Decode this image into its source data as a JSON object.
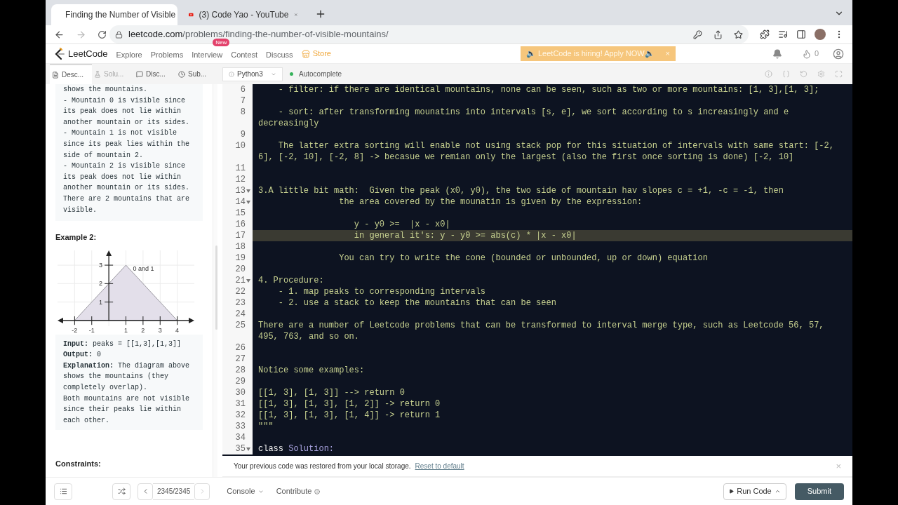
{
  "browser": {
    "tabs": [
      {
        "title": "Finding the Number of Visible",
        "kind": "leetcode",
        "selected": true
      },
      {
        "title": "(3) Code Yao - YouTube",
        "kind": "youtube",
        "selected": false
      }
    ],
    "url_host": "leetcode.com",
    "url_path": "/problems/finding-the-number-of-visible-mountains/"
  },
  "nav": {
    "logo": "LeetCode",
    "items": [
      {
        "label": "Explore"
      },
      {
        "label": "Problems"
      },
      {
        "label": "Interview",
        "badge": "New"
      },
      {
        "label": "Contest"
      },
      {
        "label": "Discuss"
      }
    ],
    "store": "Store",
    "banner": "🔈 LeetCode is hiring! Apply NOW🔈",
    "banner_close": "×",
    "streak": "0"
  },
  "panel_tabs": [
    {
      "label": "Desc...",
      "selected": true,
      "disabled": false
    },
    {
      "label": "Solu...",
      "selected": false,
      "disabled": true
    },
    {
      "label": "Disc...",
      "selected": false,
      "disabled": false
    },
    {
      "label": "Sub...",
      "selected": false,
      "disabled": false
    }
  ],
  "language": "Python3",
  "autocomplete": {
    "label": "Autocomplete",
    "on": true
  },
  "description": {
    "example1_lines": [
      "shows the mountains.",
      "- Mountain 0 is visible since its peak does not lie within another mountain or its sides.",
      "- Mountain 1 is not visible since its peak lies within the side of mountain 2.",
      "- Mountain 2 is visible since its peak does not lie within another mountain or its sides.",
      "There are 2 mountains that are visible."
    ],
    "example2_title": "Example 2:",
    "chart_data": {
      "type": "area",
      "x": [
        -2,
        1,
        4
      ],
      "series": [
        {
          "name": "0 and 1",
          "color": "#e3dfea",
          "values": [
            0,
            3,
            0
          ]
        }
      ],
      "xticks": [
        -2,
        -1,
        1,
        2,
        3,
        4
      ],
      "yticks": [
        1,
        2,
        3
      ],
      "xlim": [
        -3,
        5
      ],
      "ylim": [
        0,
        3.8
      ],
      "grid": true
    },
    "example2_fields": [
      {
        "label": "Input:",
        "value": "peaks = [[1,3],[1,3]]"
      },
      {
        "label": "Output:",
        "value": "0"
      },
      {
        "label": "Explanation:",
        "value": "The diagram above shows the mountains (they completely overlap)."
      }
    ],
    "example2_note": "Both mountains are not visible since their peaks lie within each other.",
    "constraints_title": "Constraints:"
  },
  "editor": {
    "lines": [
      {
        "n": "6",
        "text": "    - filter: if there are identical mountains, none can be seen, such as two or more mountains: [1, 3],[1, 3];",
        "fold": false,
        "active": false
      },
      {
        "n": "7",
        "fold": false,
        "active": false
      },
      {
        "n": "8",
        "text": "    - sort: after transforming mounatins into intervals [s, e], we sort according to s increasingly and e decreasingly",
        "fold": false,
        "active": false
      },
      {
        "n": "9",
        "fold": false,
        "active": false
      },
      {
        "n": "10",
        "text": "    The latter extra sorting will enable not using stack pop for this situation of intervals with same start: [-2, 6], [-2, 10], [-2, 8] -> becasue we remian only the largest (also the first once sorting is done) [-2, 10]",
        "fold": false,
        "active": false
      },
      {
        "n": "11",
        "fold": false,
        "active": false
      },
      {
        "n": "12",
        "fold": false,
        "active": false
      },
      {
        "n": "13",
        "text": "3.A little bit math:  Given the peak (x0, y0), the two side of mountain hav slopes c = +1, -c = -1, then",
        "fold": true,
        "active": false
      },
      {
        "n": "14",
        "text": "                the area covered by the mounatin is given by the expression:",
        "fold": true,
        "active": false
      },
      {
        "n": "15",
        "fold": false,
        "active": false
      },
      {
        "n": "16",
        "text": "                   y - y0 >=  |x - x0|",
        "fold": false,
        "active": false
      },
      {
        "n": "17",
        "text": "                   in general it's: y - y0 >= abs(c) * |x - x0|",
        "fold": false,
        "active": true
      },
      {
        "n": "18",
        "fold": false,
        "active": false
      },
      {
        "n": "19",
        "text": "                You can try to write the cone (bounded or unbounded, up or down) equation",
        "fold": false,
        "active": false
      },
      {
        "n": "20",
        "fold": false,
        "active": false
      },
      {
        "n": "21",
        "text": "4. Procedure:",
        "fold": true,
        "active": false
      },
      {
        "n": "22",
        "text": "    - 1. map peaks to corresponding intervals",
        "fold": false,
        "active": false
      },
      {
        "n": "23",
        "text": "    - 2. use a stack to keep the mountains that can be seen",
        "fold": false,
        "active": false
      },
      {
        "n": "24",
        "fold": false,
        "active": false
      },
      {
        "n": "25",
        "text": "There are a number of Leetcode problems that can be transformed to interval merge type, such as Leetcode 56, 57, 495, 763, and so on.",
        "fold": false,
        "active": false
      },
      {
        "n": "26",
        "fold": false,
        "active": false
      },
      {
        "n": "27",
        "fold": false,
        "active": false
      },
      {
        "n": "28",
        "text": "Notice some examples:",
        "fold": false,
        "active": false
      },
      {
        "n": "29",
        "fold": false,
        "active": false
      },
      {
        "n": "30",
        "text": "[[1, 3], [1, 3]] --> return 0",
        "fold": false,
        "active": false
      },
      {
        "n": "31",
        "text": "[[1, 3], [1, 3], [1, 2]] -> return 0",
        "fold": false,
        "active": false
      },
      {
        "n": "32",
        "text": "[[1, 3], [1, 3], [1, 4]] -> return 1",
        "fold": false,
        "active": false
      },
      {
        "n": "33",
        "text": "\"\"\"",
        "fold": false,
        "active": false
      },
      {
        "n": "34",
        "fold": false,
        "active": false
      },
      {
        "n": "35",
        "keyword": "class",
        "text": " Solution:",
        "fold": true,
        "active": false
      }
    ]
  },
  "notice": {
    "text": "Your previous code was restored from your local storage.",
    "link": "Reset to default",
    "close": "×"
  },
  "footer": {
    "progress": "2345/2345",
    "console": "Console",
    "contribute": "Contribute",
    "run": "Run Code",
    "submit": "Submit"
  }
}
